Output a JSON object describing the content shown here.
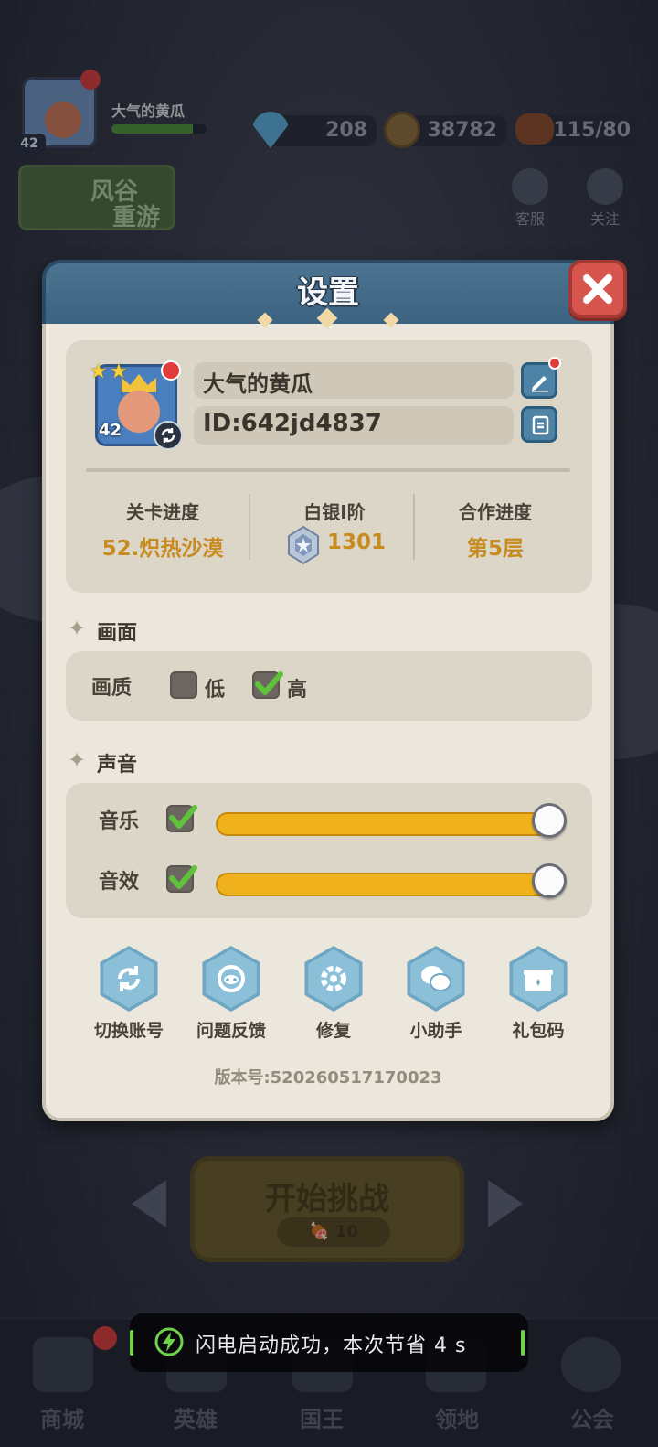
{
  "hud": {
    "player_name": "大气的黄瓜",
    "level": "42",
    "diamonds": "208",
    "coins": "38782",
    "stamina": "115/80",
    "event_label_1": "风谷",
    "event_label_2": "重游",
    "service_label": "客服",
    "follow_label": "关注",
    "exp_progress": 0.86
  },
  "battle": {
    "start_label": "开始挑战",
    "cost": "10"
  },
  "nav": {
    "items": [
      {
        "label": "商城"
      },
      {
        "label": "英雄"
      },
      {
        "label": "国王"
      },
      {
        "label": "领地"
      },
      {
        "label": "公会"
      }
    ]
  },
  "toast": {
    "message": "闪电启动成功，本次节省 4 s"
  },
  "settings": {
    "title": "设置",
    "profile": {
      "name": "大气的黄瓜",
      "id": "ID:642jd4837",
      "level": "42"
    },
    "stats": [
      {
        "label": "关卡进度",
        "value": "52.炽热沙漠"
      },
      {
        "label": "白银I阶",
        "value": "1301"
      },
      {
        "label": "合作进度",
        "value": "第5层"
      }
    ],
    "graphics": {
      "section": "画面",
      "quality_label": "画质",
      "low_label": "低",
      "high_label": "高",
      "low_checked": false,
      "high_checked": true
    },
    "sound": {
      "section": "声音",
      "music_label": "音乐",
      "sfx_label": "音效",
      "music_enabled": true,
      "sfx_enabled": true,
      "music_volume": 1.0,
      "sfx_volume": 1.0
    },
    "actions": [
      {
        "label": "切换账号",
        "icon": "switch-account-icon"
      },
      {
        "label": "问题反馈",
        "icon": "feedback-icon"
      },
      {
        "label": "修复",
        "icon": "repair-icon"
      },
      {
        "label": "小助手",
        "icon": "wechat-assistant-icon"
      },
      {
        "label": "礼包码",
        "icon": "gift-code-icon"
      }
    ],
    "version": "版本号:520260517170023"
  },
  "colors": {
    "accent_gold": "#c78b1e",
    "header_blue": "#3c6381",
    "close_red": "#d6554c",
    "slider_orange": "#f0b21c",
    "check_green": "#5ec23a"
  }
}
